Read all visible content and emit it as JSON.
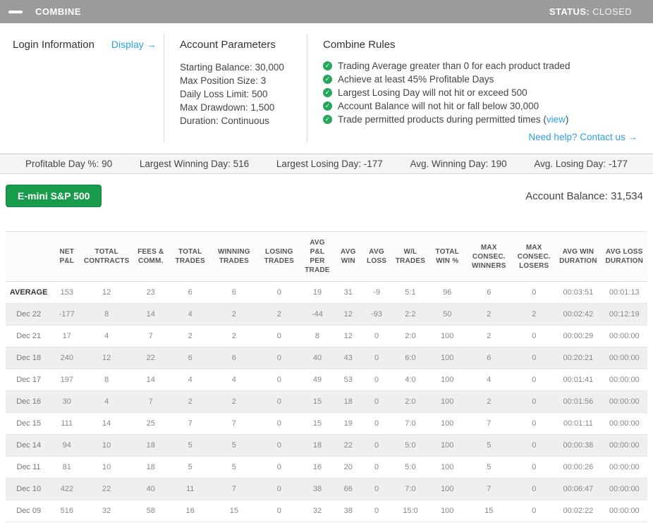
{
  "colors": {
    "topbar_bg": "#9b9b9b",
    "accent_blue": "#2e9fe3",
    "check_green": "#26a65b",
    "button_green": "#189b4a"
  },
  "topbar": {
    "title": "COMBINE",
    "status_label": "STATUS:",
    "status_value": "CLOSED"
  },
  "login": {
    "title": "Login Information",
    "display_link": "Display →"
  },
  "account_parameters": {
    "title": "Account Parameters",
    "items": [
      "Starting Balance: 30,000",
      "Max Position Size: 3",
      "Daily Loss Limit: 500",
      "Max Drawdown: 1,500",
      "Duration: Continuous"
    ]
  },
  "combine_rules": {
    "title": "Combine Rules",
    "rules": [
      "Trading Average greater than 0 for each product traded",
      "Achieve at least 45% Profitable Days",
      "Largest Losing Day will not hit or exceed 500",
      "Account Balance will not hit or fall below 30,000"
    ],
    "rule_with_link": {
      "prefix": "Trade permitted products during permitted times (",
      "link": "view",
      "suffix": ")"
    },
    "help_link": "Need help? Contact us →"
  },
  "stats": [
    {
      "label": "Profitable Day %:",
      "value": "90"
    },
    {
      "label": "Largest Winning Day:",
      "value": "516"
    },
    {
      "label": "Largest Losing Day:",
      "value": "-177"
    },
    {
      "label": "Avg. Winning Day:",
      "value": "190"
    },
    {
      "label": "Avg. Losing Day:",
      "value": "-177"
    }
  ],
  "product_button_label": "E-mini S&P 500",
  "account_balance": {
    "label": "Account Balance:",
    "value": "31,534"
  },
  "table": {
    "headers": [
      "",
      "NET P&L",
      "TOTAL CONTRACTS",
      "FEES & COMM.",
      "TOTAL TRADES",
      "WINNING TRADES",
      "LOSING TRADES",
      "AVG P&L PER TRADE",
      "AVG WIN",
      "AVG LOSS",
      "W/L TRADES",
      "TOTAL WIN %",
      "MAX CONSEC. WINNERS",
      "MAX CONSEC. LOSERS",
      "AVG WIN DURATION",
      "AVG LOSS DURATION"
    ],
    "rows": [
      {
        "label": "AVERAGE",
        "emphasis": true,
        "cells": [
          "153",
          "12",
          "23",
          "6",
          "6",
          "0",
          "19",
          "31",
          "-9",
          "5:1",
          "96",
          "6",
          "0",
          "00:03:51",
          "00:01:13"
        ]
      },
      {
        "label": "Dec 22",
        "emphasis": false,
        "cells": [
          "-177",
          "8",
          "14",
          "4",
          "2",
          "2",
          "-44",
          "12",
          "-93",
          "2:2",
          "50",
          "2",
          "2",
          "00:02:42",
          "00:12:19"
        ]
      },
      {
        "label": "Dec 21",
        "emphasis": false,
        "cells": [
          "17",
          "4",
          "7",
          "2",
          "2",
          "0",
          "8",
          "12",
          "0",
          "2:0",
          "100",
          "2",
          "0",
          "00:00:29",
          "00:00:00"
        ]
      },
      {
        "label": "Dec 18",
        "emphasis": false,
        "cells": [
          "240",
          "12",
          "22",
          "6",
          "6",
          "0",
          "40",
          "43",
          "0",
          "6:0",
          "100",
          "6",
          "0",
          "00:20:21",
          "00:00:00"
        ]
      },
      {
        "label": "Dec 17",
        "emphasis": false,
        "cells": [
          "197",
          "8",
          "14",
          "4",
          "4",
          "0",
          "49",
          "53",
          "0",
          "4:0",
          "100",
          "4",
          "0",
          "00:01:41",
          "00:00:00"
        ]
      },
      {
        "label": "Dec 16",
        "emphasis": false,
        "cells": [
          "30",
          "4",
          "7",
          "2",
          "2",
          "0",
          "15",
          "18",
          "0",
          "2:0",
          "100",
          "2",
          "0",
          "00:01:56",
          "00:00:00"
        ]
      },
      {
        "label": "Dec 15",
        "emphasis": false,
        "cells": [
          "111",
          "14",
          "25",
          "7",
          "7",
          "0",
          "15",
          "19",
          "0",
          "7:0",
          "100",
          "7",
          "0",
          "00:01:11",
          "00:00:00"
        ]
      },
      {
        "label": "Dec 14",
        "emphasis": false,
        "cells": [
          "94",
          "10",
          "18",
          "5",
          "5",
          "0",
          "18",
          "22",
          "0",
          "5:0",
          "100",
          "5",
          "0",
          "00:00:38",
          "00:00:00"
        ]
      },
      {
        "label": "Dec 11",
        "emphasis": false,
        "cells": [
          "81",
          "10",
          "18",
          "5",
          "5",
          "0",
          "16",
          "20",
          "0",
          "5:0",
          "100",
          "5",
          "0",
          "00:00:26",
          "00:00:00"
        ]
      },
      {
        "label": "Dec 10",
        "emphasis": false,
        "cells": [
          "422",
          "22",
          "40",
          "11",
          "7",
          "0",
          "38",
          "66",
          "0",
          "7:0",
          "100",
          "7",
          "0",
          "00:06:47",
          "00:00:00"
        ]
      },
      {
        "label": "Dec 09",
        "emphasis": false,
        "cells": [
          "516",
          "32",
          "58",
          "16",
          "15",
          "0",
          "32",
          "38",
          "0",
          "15:0",
          "100",
          "15",
          "0",
          "00:02:22",
          "00:00:00"
        ]
      }
    ]
  }
}
